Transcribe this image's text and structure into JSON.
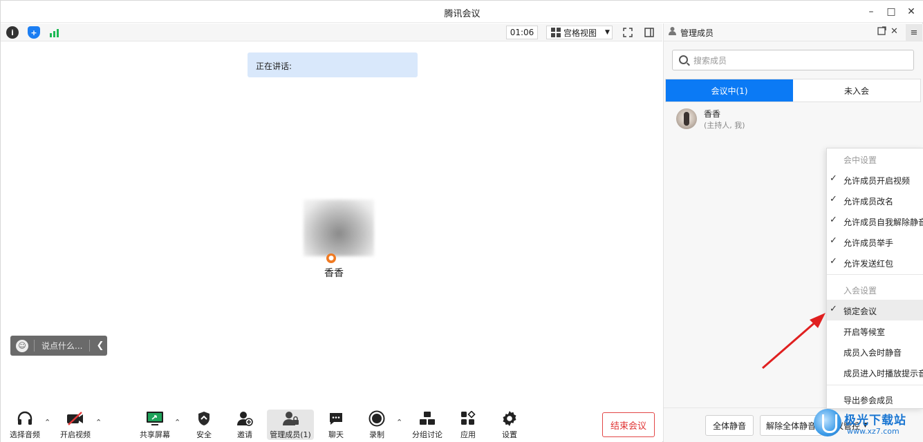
{
  "window": {
    "title": "腾讯会议",
    "controls": [
      "minimize-icon",
      "maximize-icon",
      "close-icon"
    ]
  },
  "topbar": {
    "icons": [
      "info-icon",
      "security-shield-icon",
      "signal-icon"
    ],
    "timer": "01:06",
    "view_mode": "宫格视图",
    "fullscreen_icon": "fullscreen-icon",
    "sidebar_toggle_icon": "sidebar-toggle-icon"
  },
  "stage": {
    "speaking_label": "正在讲话:",
    "participant_name": "香香",
    "chat_placeholder": "说点什么..."
  },
  "bottombar": {
    "items": [
      {
        "label": "选择音频",
        "icon": "headset-icon"
      },
      {
        "label": "开启视频",
        "icon": "video-off-icon"
      },
      {
        "label": "共享屏幕",
        "icon": "share-screen-icon"
      },
      {
        "label": "安全",
        "icon": "shield-icon"
      },
      {
        "label": "邀请",
        "icon": "invite-user-icon"
      },
      {
        "label": "管理成员(1)",
        "icon": "members-icon"
      },
      {
        "label": "聊天",
        "icon": "chat-icon"
      },
      {
        "label": "录制",
        "icon": "record-icon"
      },
      {
        "label": "分组讨论",
        "icon": "breakout-icon"
      },
      {
        "label": "应用",
        "icon": "apps-icon"
      },
      {
        "label": "设置",
        "icon": "gear-icon"
      }
    ],
    "end_label": "结束会议"
  },
  "panel": {
    "title": "管理成员",
    "search_placeholder": "搜索成员",
    "tabs": [
      {
        "label": "会议中(1)",
        "active": true
      },
      {
        "label": "未入会",
        "active": false
      }
    ],
    "members": [
      {
        "name": "香香",
        "role": "(主持人, 我)"
      }
    ],
    "footer": {
      "mute_all": "全体静音",
      "unmute_all": "解除全体静音",
      "meeting_control": "会议管控"
    }
  },
  "menu": {
    "section1_title": "会中设置",
    "section1_items": [
      {
        "label": "允许成员开启视频",
        "checked": true
      },
      {
        "label": "允许成员改名",
        "checked": true
      },
      {
        "label": "允许成员自我解除静音",
        "checked": true
      },
      {
        "label": "允许成员举手",
        "checked": true
      },
      {
        "label": "允许发送红包",
        "checked": true
      }
    ],
    "section2_title": "入会设置",
    "section2_items": [
      {
        "label": "锁定会议",
        "checked": true
      },
      {
        "label": "开启等候室",
        "checked": false
      },
      {
        "label": "成员入会时静音",
        "checked": false
      },
      {
        "label": "成员进入时播放提示音",
        "checked": false
      }
    ],
    "export_label": "导出参会成员"
  },
  "watermark": {
    "name": "极光下载站",
    "url": "www.xz7.com"
  },
  "colors": {
    "accent_blue": "#0b7af5",
    "end_red": "#e03434",
    "speaking_bg": "#d9e8fb",
    "annotation_arrow": "#e02020"
  }
}
